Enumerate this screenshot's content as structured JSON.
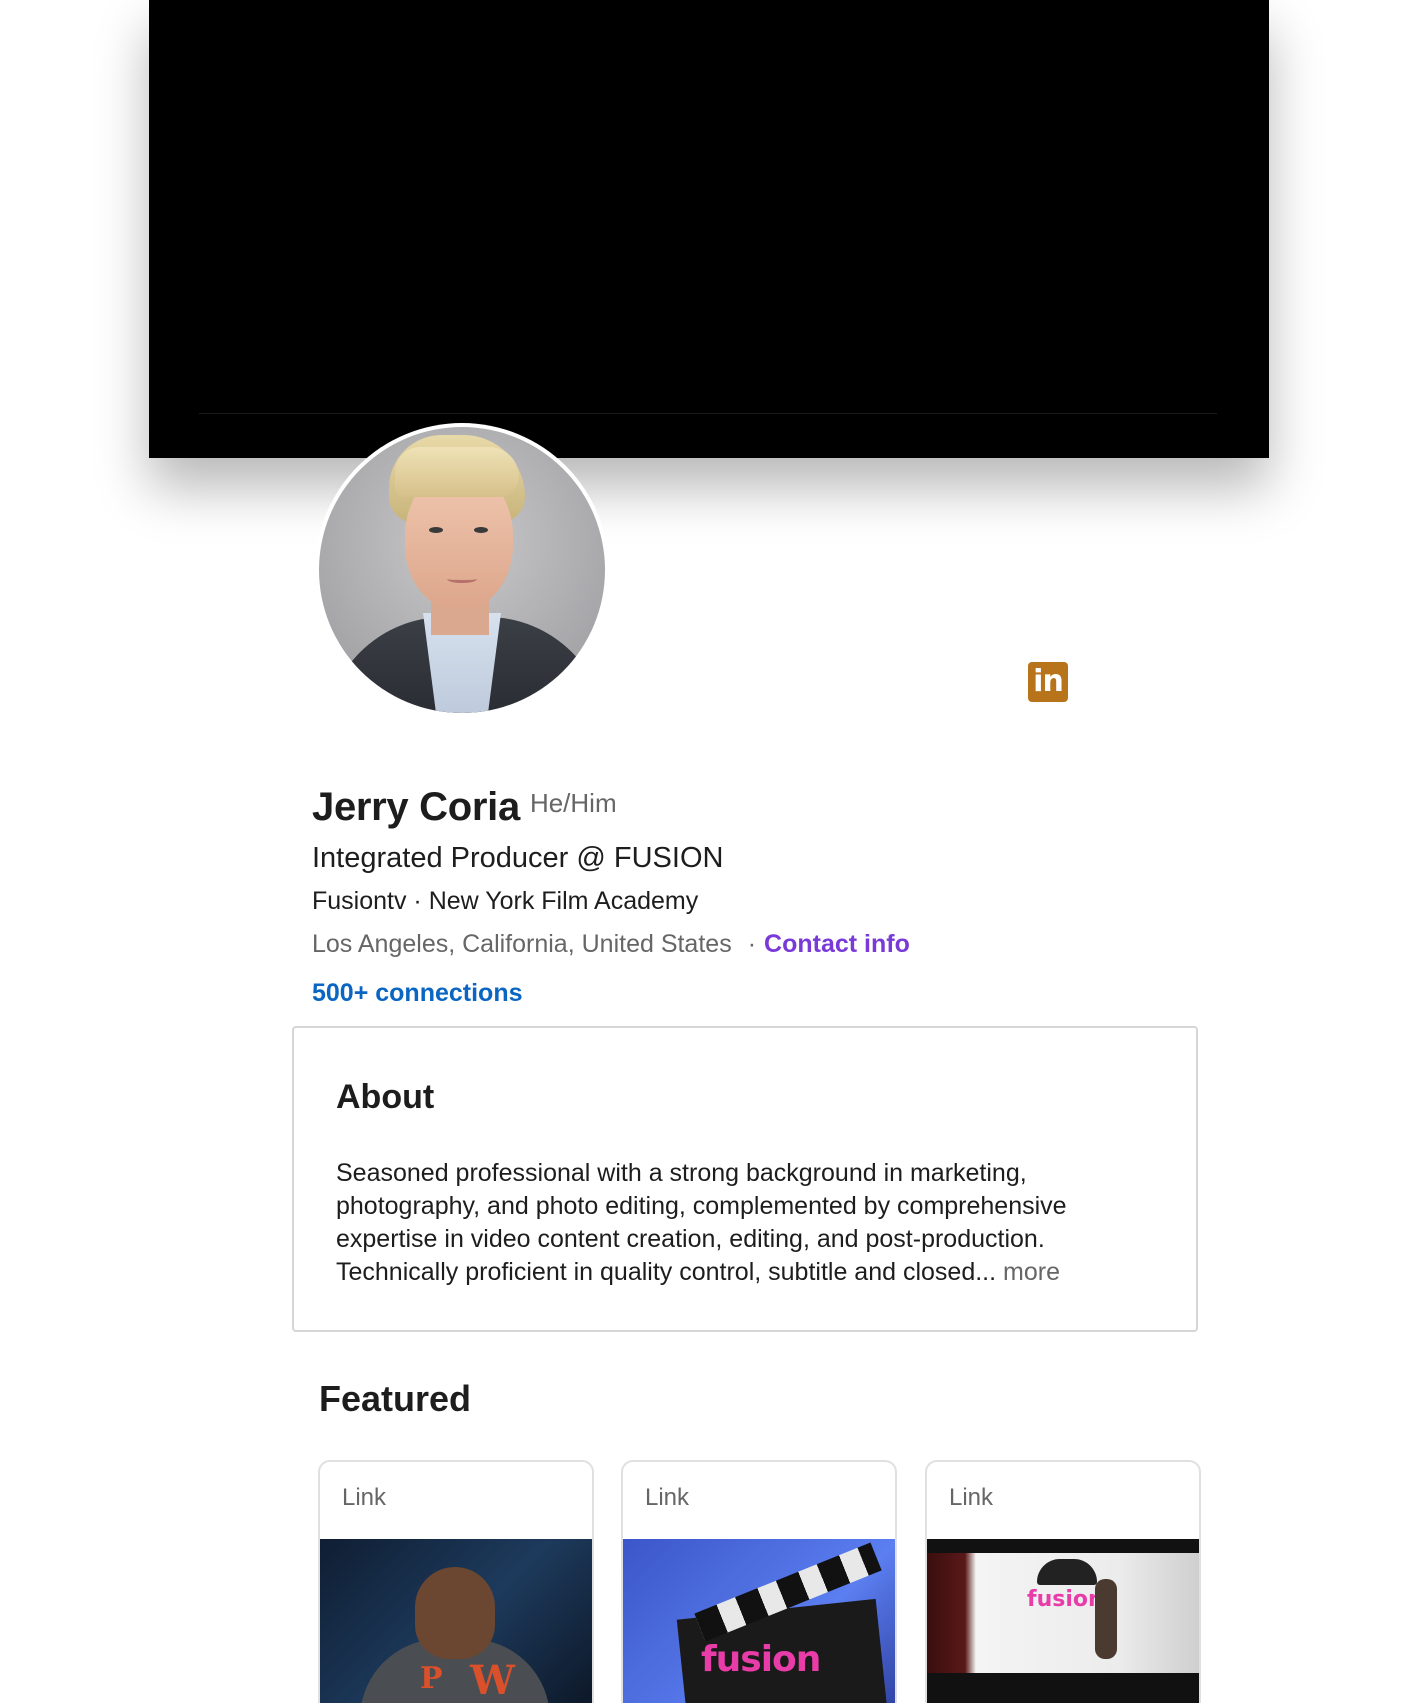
{
  "profile": {
    "name": "Jerry Coria",
    "pronouns": "He/Him",
    "headline": "Integrated Producer @ FUSION",
    "subline": "Fusiontv · New York Film Academy",
    "location": "Los Angeles, California, United States",
    "separator": "·",
    "contact_label": "Contact info",
    "connections": "500+ connections",
    "linkedin_badge": "in"
  },
  "about": {
    "title": "About",
    "text": "Seasoned professional with a strong background in marketing, photography, and photo editing, complemented by comprehensive expertise in video content creation, editing, and post-production. Technically proficient in quality control, subtitle and closed...",
    "more_label": "more"
  },
  "featured": {
    "title": "Featured",
    "cards": [
      {
        "kind": "Link"
      },
      {
        "kind": "Link",
        "thumb_logo": "fusion"
      },
      {
        "kind": "Link",
        "thumb_logo": "fusion"
      }
    ]
  },
  "icons": {
    "linkedin": "linkedin-icon"
  },
  "colors": {
    "link_blue": "#0a66c2",
    "contact_purple": "#7a3ad8",
    "badge_orange": "#b8741a",
    "cover": "#000000"
  }
}
